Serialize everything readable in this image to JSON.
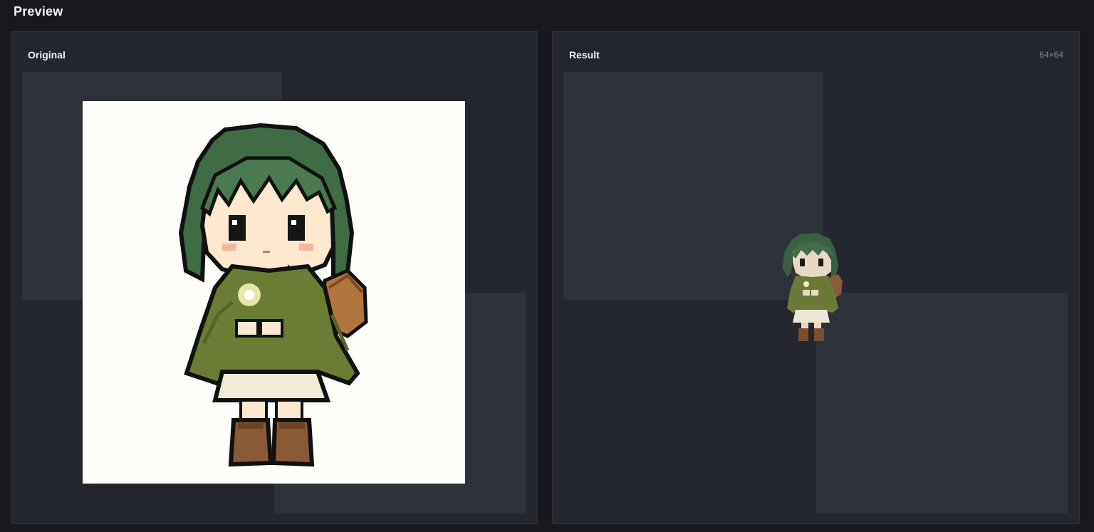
{
  "header": {
    "title": "Preview"
  },
  "panels": {
    "original": {
      "label": "Original"
    },
    "result": {
      "label": "Result",
      "size": "64×64"
    }
  },
  "colors": {
    "background": "#17191f",
    "panel": "#23262f",
    "checker_light": "#2d313a",
    "hair": "#3f6b45",
    "cloak": "#6b7c34",
    "dress": "#f1ead6",
    "boots": "#8a5a37",
    "basket": "#b3753f"
  },
  "icons": {
    "original_sprite": "pixel-girl-sprite",
    "result_sprite": "pixel-girl-sprite-small"
  }
}
